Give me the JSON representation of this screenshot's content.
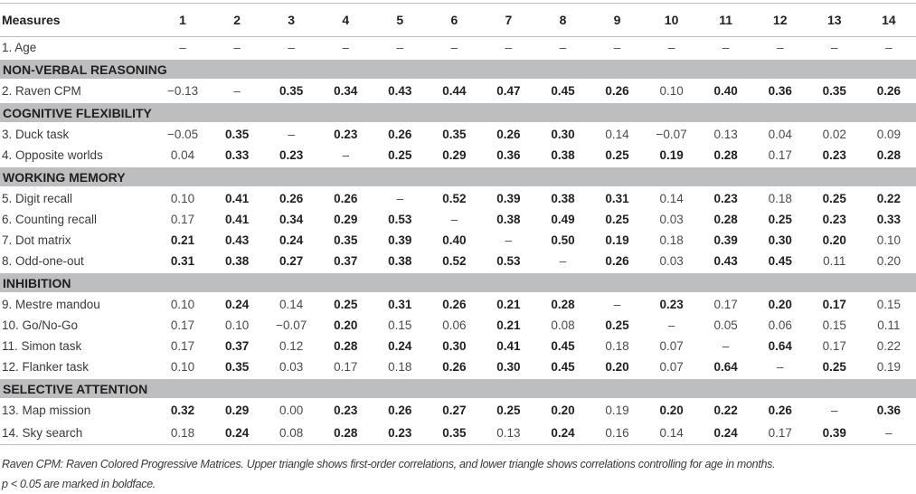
{
  "header": {
    "measures": "Measures",
    "columns": [
      "1",
      "2",
      "3",
      "4",
      "5",
      "6",
      "7",
      "8",
      "9",
      "10",
      "11",
      "12",
      "13",
      "14"
    ]
  },
  "rows": [
    {
      "type": "row",
      "label": "1. Age",
      "cells": [
        [
          "–",
          0
        ],
        [
          "–",
          0
        ],
        [
          "–",
          0
        ],
        [
          "–",
          0
        ],
        [
          "–",
          0
        ],
        [
          "–",
          0
        ],
        [
          "–",
          0
        ],
        [
          "–",
          0
        ],
        [
          "–",
          0
        ],
        [
          "–",
          0
        ],
        [
          "–",
          0
        ],
        [
          "–",
          0
        ],
        [
          "–",
          0
        ],
        [
          "–",
          0
        ]
      ]
    },
    {
      "type": "section",
      "label": "NON-VERBAL REASONING"
    },
    {
      "type": "row",
      "label": "2. Raven CPM",
      "cells": [
        [
          "−0.13",
          0
        ],
        [
          "–",
          0
        ],
        [
          "0.35",
          1
        ],
        [
          "0.34",
          1
        ],
        [
          "0.43",
          1
        ],
        [
          "0.44",
          1
        ],
        [
          "0.47",
          1
        ],
        [
          "0.45",
          1
        ],
        [
          "0.26",
          1
        ],
        [
          "0.10",
          0
        ],
        [
          "0.40",
          1
        ],
        [
          "0.36",
          1
        ],
        [
          "0.35",
          1
        ],
        [
          "0.26",
          1
        ]
      ]
    },
    {
      "type": "section",
      "label": "COGNITIVE FLEXIBILITY"
    },
    {
      "type": "row",
      "label": "3. Duck task",
      "cells": [
        [
          "−0.05",
          0
        ],
        [
          "0.35",
          1
        ],
        [
          "–",
          0
        ],
        [
          "0.23",
          1
        ],
        [
          "0.26",
          1
        ],
        [
          "0.35",
          1
        ],
        [
          "0.26",
          1
        ],
        [
          "0.30",
          1
        ],
        [
          "0.14",
          0
        ],
        [
          "−0.07",
          0
        ],
        [
          "0.13",
          0
        ],
        [
          "0.04",
          0
        ],
        [
          "0.02",
          0
        ],
        [
          "0.09",
          0
        ]
      ]
    },
    {
      "type": "row",
      "label": "4. Opposite worlds",
      "cells": [
        [
          "0.04",
          0
        ],
        [
          "0.33",
          1
        ],
        [
          "0.23",
          1
        ],
        [
          "–",
          0
        ],
        [
          "0.25",
          1
        ],
        [
          "0.29",
          1
        ],
        [
          "0.36",
          1
        ],
        [
          "0.38",
          1
        ],
        [
          "0.25",
          1
        ],
        [
          "0.19",
          1
        ],
        [
          "0.28",
          1
        ],
        [
          "0.17",
          0
        ],
        [
          "0.23",
          1
        ],
        [
          "0.28",
          1
        ]
      ]
    },
    {
      "type": "section",
      "label": "WORKING MEMORY"
    },
    {
      "type": "row",
      "label": "5. Digit recall",
      "cells": [
        [
          "0.10",
          0
        ],
        [
          "0.41",
          1
        ],
        [
          "0.26",
          1
        ],
        [
          "0.26",
          1
        ],
        [
          "–",
          0
        ],
        [
          "0.52",
          1
        ],
        [
          "0.39",
          1
        ],
        [
          "0.38",
          1
        ],
        [
          "0.31",
          1
        ],
        [
          "0.14",
          0
        ],
        [
          "0.23",
          1
        ],
        [
          "0.18",
          0
        ],
        [
          "0.25",
          1
        ],
        [
          "0.22",
          1
        ]
      ]
    },
    {
      "type": "row",
      "label": "6. Counting recall",
      "cells": [
        [
          "0.17",
          0
        ],
        [
          "0.41",
          1
        ],
        [
          "0.34",
          1
        ],
        [
          "0.29",
          1
        ],
        [
          "0.53",
          1
        ],
        [
          "–",
          0
        ],
        [
          "0.38",
          1
        ],
        [
          "0.49",
          1
        ],
        [
          "0.25",
          1
        ],
        [
          "0.03",
          0
        ],
        [
          "0.28",
          1
        ],
        [
          "0.25",
          1
        ],
        [
          "0.23",
          1
        ],
        [
          "0.33",
          1
        ]
      ]
    },
    {
      "type": "row",
      "label": "7. Dot matrix",
      "cells": [
        [
          "0.21",
          1
        ],
        [
          "0.43",
          1
        ],
        [
          "0.24",
          1
        ],
        [
          "0.35",
          1
        ],
        [
          "0.39",
          1
        ],
        [
          "0.40",
          1
        ],
        [
          "–",
          0
        ],
        [
          "0.50",
          1
        ],
        [
          "0.19",
          1
        ],
        [
          "0.18",
          0
        ],
        [
          "0.39",
          1
        ],
        [
          "0.30",
          1
        ],
        [
          "0.20",
          1
        ],
        [
          "0.10",
          0
        ]
      ]
    },
    {
      "type": "row",
      "label": "8. Odd-one-out",
      "cells": [
        [
          "0.31",
          1
        ],
        [
          "0.38",
          1
        ],
        [
          "0.27",
          1
        ],
        [
          "0.37",
          1
        ],
        [
          "0.38",
          1
        ],
        [
          "0.52",
          1
        ],
        [
          "0.53",
          1
        ],
        [
          "–",
          0
        ],
        [
          "0.26",
          1
        ],
        [
          "0.03",
          0
        ],
        [
          "0.43",
          1
        ],
        [
          "0.45",
          1
        ],
        [
          "0.11",
          0
        ],
        [
          "0.20",
          0
        ]
      ]
    },
    {
      "type": "section",
      "label": "INHIBITION"
    },
    {
      "type": "row",
      "label": "9. Mestre mandou",
      "cells": [
        [
          "0.10",
          0
        ],
        [
          "0.24",
          1
        ],
        [
          "0.14",
          0
        ],
        [
          "0.25",
          1
        ],
        [
          "0.31",
          1
        ],
        [
          "0.26",
          1
        ],
        [
          "0.21",
          1
        ],
        [
          "0.28",
          1
        ],
        [
          "–",
          0
        ],
        [
          "0.23",
          1
        ],
        [
          "0.17",
          0
        ],
        [
          "0.20",
          1
        ],
        [
          "0.17",
          1
        ],
        [
          "0.15",
          0
        ]
      ]
    },
    {
      "type": "row",
      "label": "10. Go/No-Go",
      "cells": [
        [
          "0.17",
          0
        ],
        [
          "0.10",
          0
        ],
        [
          "−0.07",
          0
        ],
        [
          "0.20",
          1
        ],
        [
          "0.15",
          0
        ],
        [
          "0.06",
          0
        ],
        [
          "0.21",
          1
        ],
        [
          "0.08",
          0
        ],
        [
          "0.25",
          1
        ],
        [
          "–",
          0
        ],
        [
          "0.05",
          0
        ],
        [
          "0.06",
          0
        ],
        [
          "0.15",
          0
        ],
        [
          "0.11",
          0
        ]
      ]
    },
    {
      "type": "row",
      "label": "11. Simon task",
      "cells": [
        [
          "0.17",
          0
        ],
        [
          "0.37",
          1
        ],
        [
          "0.12",
          0
        ],
        [
          "0.28",
          1
        ],
        [
          "0.24",
          1
        ],
        [
          "0.30",
          1
        ],
        [
          "0.41",
          1
        ],
        [
          "0.45",
          1
        ],
        [
          "0.18",
          0
        ],
        [
          "0.07",
          0
        ],
        [
          "–",
          0
        ],
        [
          "0.64",
          1
        ],
        [
          "0.17",
          0
        ],
        [
          "0.22",
          0
        ]
      ]
    },
    {
      "type": "row",
      "label": "12. Flanker task",
      "cells": [
        [
          "0.10",
          0
        ],
        [
          "0.35",
          1
        ],
        [
          "0.03",
          0
        ],
        [
          "0.17",
          0
        ],
        [
          "0.18",
          0
        ],
        [
          "0.26",
          1
        ],
        [
          "0.30",
          1
        ],
        [
          "0.45",
          1
        ],
        [
          "0.20",
          1
        ],
        [
          "0.07",
          0
        ],
        [
          "0.64",
          1
        ],
        [
          "–",
          0
        ],
        [
          "0.25",
          1
        ],
        [
          "0.19",
          0
        ]
      ]
    },
    {
      "type": "section",
      "label": "SELECTIVE ATTENTION"
    },
    {
      "type": "row",
      "label": "13. Map mission",
      "cells": [
        [
          "0.32",
          1
        ],
        [
          "0.29",
          1
        ],
        [
          "0.00",
          0
        ],
        [
          "0.23",
          1
        ],
        [
          "0.26",
          1
        ],
        [
          "0.27",
          1
        ],
        [
          "0.25",
          1
        ],
        [
          "0.20",
          1
        ],
        [
          "0.19",
          0
        ],
        [
          "0.20",
          1
        ],
        [
          "0.22",
          1
        ],
        [
          "0.26",
          1
        ],
        [
          "–",
          0
        ],
        [
          "0.36",
          1
        ]
      ]
    },
    {
      "type": "row",
      "label": "14. Sky search",
      "cells": [
        [
          "0.18",
          0
        ],
        [
          "0.24",
          1
        ],
        [
          "0.08",
          0
        ],
        [
          "0.28",
          1
        ],
        [
          "0.23",
          1
        ],
        [
          "0.35",
          1
        ],
        [
          "0.13",
          0
        ],
        [
          "0.24",
          1
        ],
        [
          "0.16",
          0
        ],
        [
          "0.14",
          0
        ],
        [
          "0.24",
          1
        ],
        [
          "0.17",
          0
        ],
        [
          "0.39",
          1
        ],
        [
          "–",
          0
        ]
      ]
    }
  ],
  "footnote": {
    "line1": "Raven CPM: Raven Colored Progressive Matrices. Upper triangle shows first-order correlations, and lower triangle shows correlations controlling for age in months.",
    "line2": "p < 0.05 are marked in boldface."
  }
}
